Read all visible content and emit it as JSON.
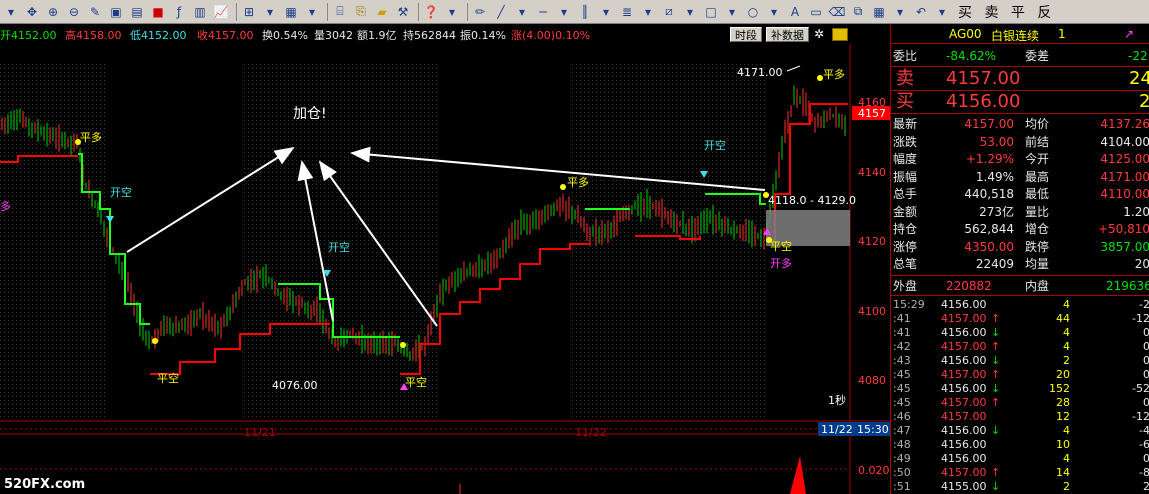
{
  "toolbar": {
    "trade_text": "买 卖 平 反"
  },
  "infobar": {
    "open": "开4152.00",
    "high": "高4158.00",
    "low": "低4152.00",
    "close": "收4157.00",
    "turnover": "换0.54%",
    "volume": "量3042",
    "amount": "额1.9亿",
    "position": "持562844",
    "amplitude": "振0.14%",
    "change": "涨(4.00)0.10%",
    "btn_period": "时段",
    "btn_supplement": "补数据"
  },
  "chart": {
    "annotation": "加仓!",
    "price_ticks": [
      "4160",
      "4140",
      "4120",
      "4100",
      "4080"
    ],
    "dates": [
      "11/21",
      "11/22"
    ],
    "date_cursor": "11/22",
    "time_cursor": "15:30",
    "current_price": "4157",
    "sub_tick": "0.020",
    "period_label": "1秒",
    "low_label": "4076.00",
    "high_label": "4171.00",
    "range_label": "4118.0 - 4129.0",
    "watermark": "520FX.com",
    "signals": {
      "open_long": "开多",
      "close_long": "平多",
      "open_short": "开空",
      "close_short": "平空",
      "open_long_partial": "多"
    },
    "colors": {
      "up": "#ff3030",
      "down": "#00d000",
      "stop_red": "#ff0000",
      "stop_green": "#20ff20",
      "arrow": "#ffffff"
    }
  },
  "panel": {
    "code": "AG00",
    "name": "白银连续",
    "index": "1",
    "ratio_label": "委比",
    "ratio_value": "-84.62%",
    "diff_label": "委差",
    "diff_value": "-22",
    "sell_label": "卖",
    "sell_price": "4157.00",
    "sell_qty": "24",
    "buy_label": "买",
    "buy_price": "4156.00",
    "buy_qty": "2",
    "stats": [
      {
        "l1": "最新",
        "v1": "4157.00",
        "c1": "red",
        "l2": "均价",
        "v2": "4137.26",
        "c2": "red"
      },
      {
        "l1": "涨跌",
        "v1": "53.00",
        "c1": "red",
        "l2": "前结",
        "v2": "4104.00",
        "c2": "white"
      },
      {
        "l1": "幅度",
        "v1": "+1.29%",
        "c1": "red",
        "l2": "今开",
        "v2": "4125.00",
        "c2": "red"
      },
      {
        "l1": "振幅",
        "v1": "1.49%",
        "c1": "white",
        "l2": "最高",
        "v2": "4171.00",
        "c2": "red"
      },
      {
        "l1": "总手",
        "v1": "440,518",
        "c1": "white",
        "l2": "最低",
        "v2": "4110.00",
        "c2": "red"
      },
      {
        "l1": "金额",
        "v1": "273亿",
        "c1": "white",
        "l2": "量比",
        "v2": "1.20",
        "c2": "white"
      },
      {
        "l1": "持仓",
        "v1": "562,844",
        "c1": "white",
        "l2": "增仓",
        "v2": "+50,810",
        "c2": "red"
      },
      {
        "l1": "涨停",
        "v1": "4350.00",
        "c1": "red",
        "l2": "跌停",
        "v2": "3857.00",
        "c2": "green"
      },
      {
        "l1": "总笔",
        "v1": "22409",
        "c1": "white",
        "l2": "均量",
        "v2": "20",
        "c2": "white"
      }
    ],
    "outer_label": "外盘",
    "outer_value": "220882",
    "inner_label": "内盘",
    "inner_value": "219636",
    "ticks": [
      {
        "t": "15:29",
        "p": "4156.00",
        "a": "",
        "v": "4",
        "d": "-2"
      },
      {
        "t": ":41",
        "p": "4157.00",
        "a": "↑",
        "v": "44",
        "d": "-12"
      },
      {
        "t": ":41",
        "p": "4156.00",
        "a": "↓",
        "v": "4",
        "d": "0"
      },
      {
        "t": ":42",
        "p": "4157.00",
        "a": "↑",
        "v": "4",
        "d": "0"
      },
      {
        "t": ":43",
        "p": "4156.00",
        "a": "↓",
        "v": "2",
        "d": "0"
      },
      {
        "t": ":45",
        "p": "4157.00",
        "a": "↑",
        "v": "20",
        "d": "0"
      },
      {
        "t": ":45",
        "p": "4156.00",
        "a": "↓",
        "v": "152",
        "d": "-52"
      },
      {
        "t": ":45",
        "p": "4157.00",
        "a": "↑",
        "v": "28",
        "d": "0"
      },
      {
        "t": ":46",
        "p": "4157.00",
        "a": "",
        "v": "12",
        "d": "-12"
      },
      {
        "t": ":47",
        "p": "4156.00",
        "a": "↓",
        "v": "4",
        "d": "-4"
      },
      {
        "t": ":48",
        "p": "4156.00",
        "a": "",
        "v": "10",
        "d": "-6"
      },
      {
        "t": ":49",
        "p": "4156.00",
        "a": "",
        "v": "4",
        "d": "0"
      },
      {
        "t": ":50",
        "p": "4157.00",
        "a": "↑",
        "v": "14",
        "d": "-8"
      },
      {
        "t": ":51",
        "p": "4155.00",
        "a": "↓",
        "v": "2",
        "d": "2"
      }
    ]
  }
}
